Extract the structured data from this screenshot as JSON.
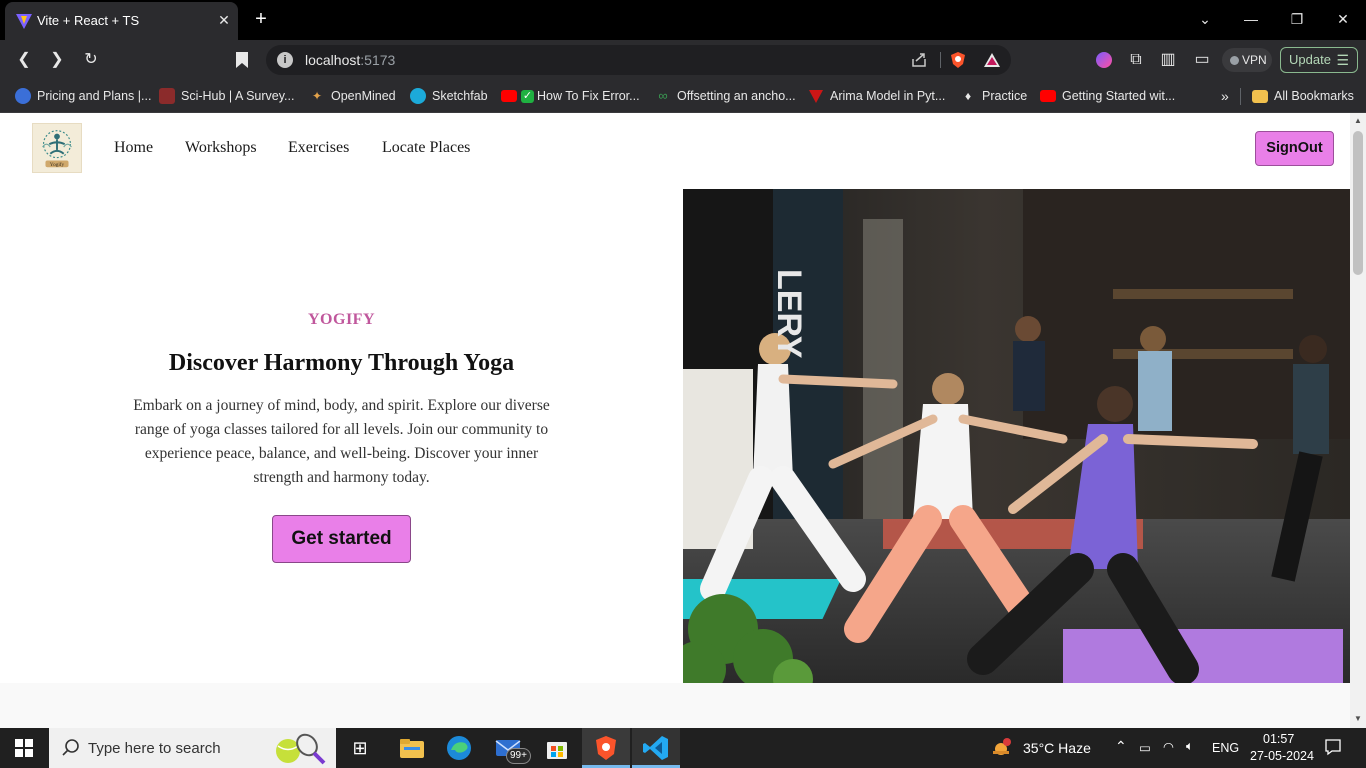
{
  "browser": {
    "tab_title": "Vite + React + TS",
    "url_host": "localhost",
    "url_port": ":5173",
    "vpn_label": "VPN",
    "update_label": "Update",
    "bookmarks": [
      {
        "label": "Pricing and Plans |...",
        "icon": "globe-icon",
        "color": "#3b6fd8"
      },
      {
        "label": "Sci-Hub | A Survey...",
        "icon": "scihub-icon",
        "color": "#8b2b2b"
      },
      {
        "label": "OpenMined",
        "icon": "openmined-icon",
        "color": "#e2a24a"
      },
      {
        "label": "Sketchfab",
        "icon": "sketchfab-icon",
        "color": "#1caad9"
      },
      {
        "label": "How To Fix Error...",
        "icon": "youtube-icon",
        "color": "#ff0000"
      },
      {
        "label": "Offsetting an ancho...",
        "icon": "link-icon",
        "color": "#3a9a52"
      },
      {
        "label": "Arima Model in Pyt...",
        "icon": "shield-icon",
        "color": "#cc1616"
      },
      {
        "label": "Practice",
        "icon": "bell-icon",
        "color": "#e8e8e8"
      },
      {
        "label": "Getting Started wit...",
        "icon": "youtube-icon",
        "color": "#ff0000"
      }
    ],
    "all_bookmarks_label": "All Bookmarks"
  },
  "site": {
    "logo_alt": "Yogify",
    "nav": [
      "Home",
      "Workshops",
      "Exercises",
      "Locate Places"
    ],
    "signout_label": "SignOut",
    "hero": {
      "eyebrow": "YOGIFY",
      "title": "Discover Harmony Through Yoga",
      "description": "Embark on a journey of mind, body, and spirit. Explore our diverse range of yoga classes tailored for all levels. Join our community to experience peace, balance, and well-being. Discover your inner strength and harmony today.",
      "cta_label": "Get started"
    },
    "colors": {
      "accent": "#e97fe8",
      "eyebrow": "#c0579c"
    }
  },
  "taskbar": {
    "search_placeholder": "Type here to search",
    "weather": "35°C  Haze",
    "language": "ENG",
    "time": "01:57",
    "date": "27-05-2024",
    "mail_badge": "99+"
  }
}
